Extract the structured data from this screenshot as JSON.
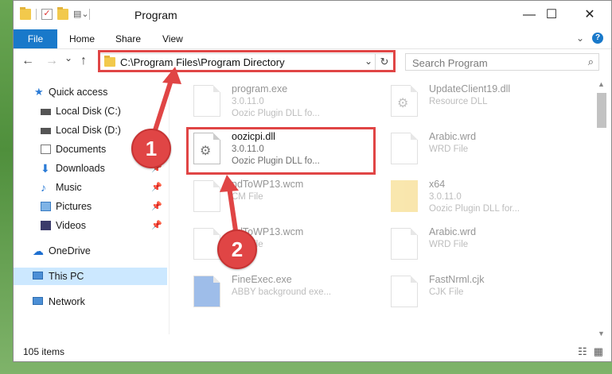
{
  "window": {
    "title": "Program",
    "minimize": "—",
    "maximize": "☐",
    "close": "✕"
  },
  "ribbon": {
    "file": "File",
    "tabs": [
      "Home",
      "Share",
      "View"
    ],
    "expand_icon": "chevron-down-icon",
    "help_label": "?"
  },
  "nav": {
    "back": "←",
    "forward": "→",
    "recent": "⌄",
    "up": "↑",
    "address": "C:\\Program Files\\Program Directory",
    "dropdown": "⌄",
    "refresh": "↻",
    "search_placeholder": "Search Program",
    "search_icon": "⌕"
  },
  "sidebar": {
    "items": [
      {
        "label": "Quick access",
        "icon": "star-icon"
      },
      {
        "label": "Local Disk (C:)",
        "icon": "drive-icon"
      },
      {
        "label": "Local Disk (D:)",
        "icon": "drive-icon"
      },
      {
        "label": "Documents",
        "icon": "documents-icon"
      },
      {
        "label": "Downloads",
        "icon": "download-icon",
        "pin": "📌"
      },
      {
        "label": "Music",
        "icon": "music-icon",
        "pin": "📌"
      },
      {
        "label": "Pictures",
        "icon": "pictures-icon",
        "pin": "📌"
      },
      {
        "label": "Videos",
        "icon": "videos-icon",
        "pin": "📌"
      },
      {
        "label": "OneDrive",
        "icon": "cloud-icon"
      },
      {
        "label": "This PC",
        "icon": "computer-icon",
        "selected": true
      },
      {
        "label": "Network",
        "icon": "network-icon"
      }
    ]
  },
  "files": {
    "left": [
      {
        "name": "program.exe",
        "sub1": "3.0.11.0",
        "sub2": "Oozic Plugin DLL fo...",
        "faded": true
      },
      {
        "name": "oozicpi.dll",
        "sub1": "3.0.11.0",
        "sub2": "Oozic Plugin DLL fo...",
        "faded": false
      },
      {
        "name": "ndToWP13.wcm",
        "sub1": "CM File",
        "sub2": "",
        "faded": true
      },
      {
        "name": "ndToWP13.wcm",
        "sub1": "CM File",
        "sub2": "",
        "faded": true
      },
      {
        "name": "FineExec.exe",
        "sub1": "ABBY background exe...",
        "sub2": "",
        "faded": true
      }
    ],
    "right": [
      {
        "name": "UpdateClient19.dll",
        "sub1": "Resource DLL",
        "sub2": "",
        "faded": true
      },
      {
        "name": "Arabic.wrd",
        "sub1": "WRD File",
        "sub2": "",
        "faded": true
      },
      {
        "name": "x64",
        "sub1": "3.0.11.0",
        "sub2": "Oozic Plugin DLL for...",
        "faded": true
      },
      {
        "name": "Arabic.wrd",
        "sub1": "WRD File",
        "sub2": "",
        "faded": true
      },
      {
        "name": "FastNrml.cjk",
        "sub1": "CJK File",
        "sub2": "",
        "faded": true
      }
    ]
  },
  "status": {
    "count": "105 items"
  },
  "annotations": {
    "badge1": "1",
    "badge2": "2",
    "color": "#e04545"
  }
}
